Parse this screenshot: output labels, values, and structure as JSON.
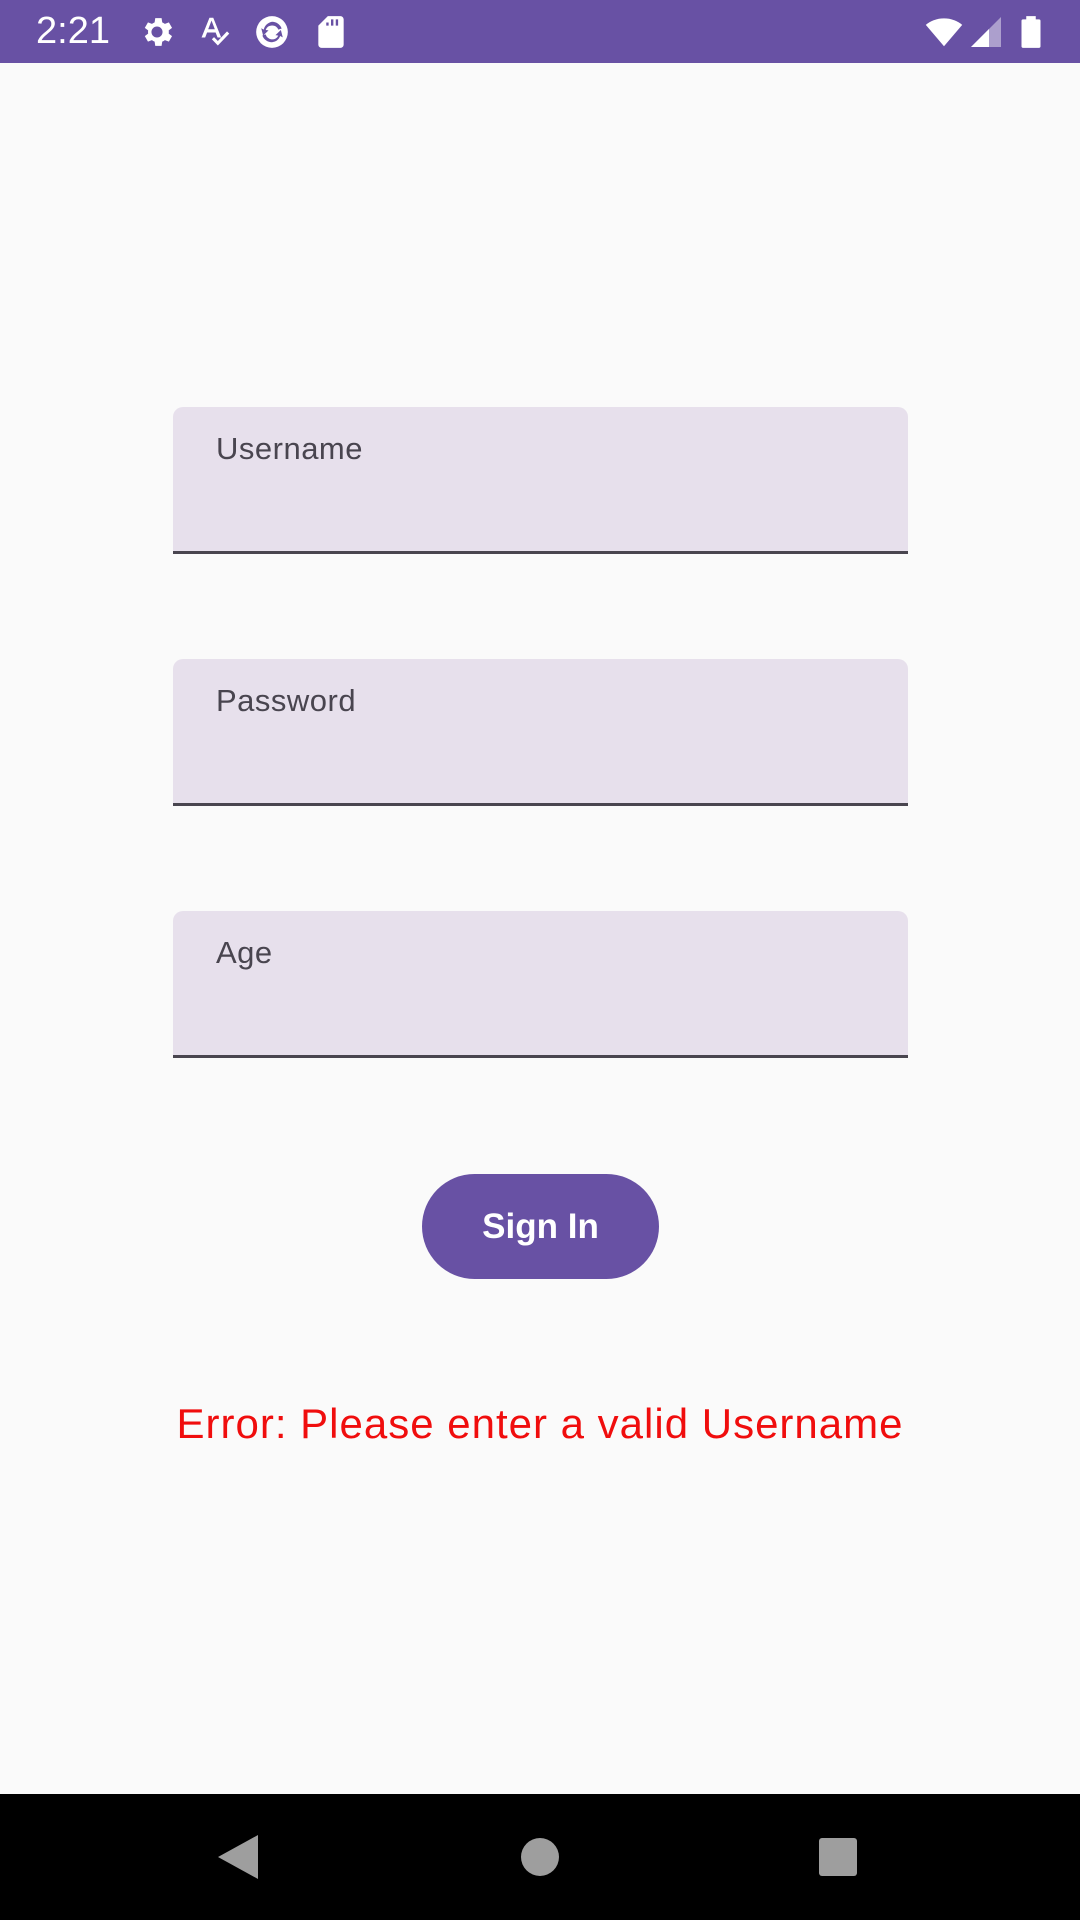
{
  "status_bar": {
    "time": "2:21",
    "background_color": "#6851a4",
    "left_icons": [
      "gear-icon",
      "spellcheck-icon",
      "sync-icon",
      "sd-card-icon"
    ],
    "right_icons": [
      "wifi-icon",
      "cell-signal-icon",
      "battery-icon"
    ]
  },
  "form": {
    "username": {
      "label": "Username",
      "value": ""
    },
    "password": {
      "label": "Password",
      "value": ""
    },
    "age": {
      "label": "Age",
      "value": ""
    },
    "field_color": "#e7e0ec"
  },
  "sign_in_button": {
    "label": "Sign In",
    "color": "#6851a4"
  },
  "error": {
    "message": "Error: Please enter a valid Username",
    "color": "#f00d0d"
  },
  "nav_bar": {
    "buttons": [
      "back-icon",
      "home-icon",
      "recents-icon"
    ]
  }
}
